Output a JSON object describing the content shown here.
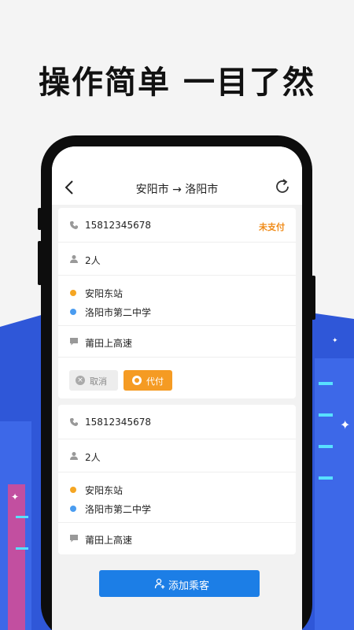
{
  "headline": "操作简单 一目了然",
  "nav": {
    "title": "安阳市 → 洛阳市",
    "back_icon": "chevron-left-icon",
    "refresh_icon": "refresh-icon"
  },
  "orders": [
    {
      "phone": "15812345678",
      "status": "未支付",
      "passengers": "2人",
      "from": "安阳东站",
      "to": "洛阳市第二中学",
      "note": "莆田上高速",
      "cancel_label": "取消",
      "pay_label": "代付"
    },
    {
      "phone": "15812345678",
      "passengers": "2人",
      "from": "安阳东站",
      "to": "洛阳市第二中学",
      "note": "莆田上高速"
    }
  ],
  "add_passenger_label": "添加乘客",
  "colors": {
    "accent_blue": "#1c7ee6",
    "pay_orange": "#f59b23",
    "status_orange": "#f08c1a",
    "origin_dot": "#f5a623",
    "destination_dot": "#4a9cf0"
  }
}
